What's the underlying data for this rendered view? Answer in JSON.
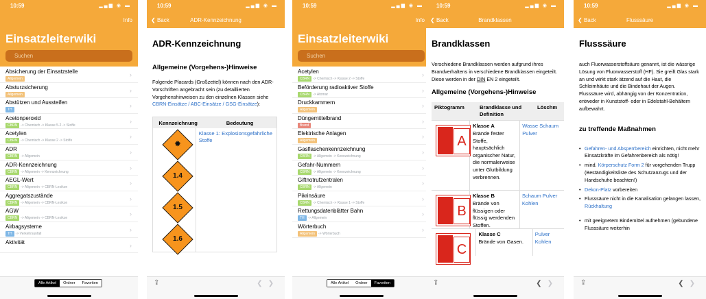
{
  "status": {
    "time": "10:59",
    "icons": "▂▄▆ ◉ ▬"
  },
  "colors": {
    "accent": "#f5a93a",
    "search_bg": "#c96f1c",
    "link": "#2b6fc7",
    "cbrn": "#a8d86e",
    "allgemein": "#f3c27a",
    "th": "#7fb7e6",
    "brand": "#e8867a"
  },
  "screen1": {
    "nav_info": "Info",
    "title": "Einsatzleiterwiki",
    "search_placeholder": "Suchen",
    "items": [
      {
        "name": "Absicherung der Einsatzstelle",
        "badge": "Allgemein",
        "badge_color": "allgemein",
        "path": ""
      },
      {
        "name": "Absturzsicherung",
        "badge": "Allgemein",
        "badge_color": "allgemein",
        "path": ""
      },
      {
        "name": "Abstützen und Aussteifen",
        "badge": "TH",
        "badge_color": "th",
        "path": ""
      },
      {
        "name": "Acetonperoxid",
        "badge": "CBRN",
        "badge_color": "cbrn",
        "path": "-> Chemisch -> Klasse 5-2 -> Stoffe"
      },
      {
        "name": "Acetylen",
        "badge": "CBRN",
        "badge_color": "cbrn",
        "path": "-> Chemisch -> Klasse 2 -> Stoffe"
      },
      {
        "name": "ADR",
        "badge": "CBRN",
        "badge_color": "cbrn",
        "path": "-> Allgemein"
      },
      {
        "name": "ADR-Kennzeichnung",
        "badge": "CBRN",
        "badge_color": "cbrn",
        "path": "-> Allgemein -> Kennzeichnung"
      },
      {
        "name": "AEGL-Wert",
        "badge": "CBRN",
        "badge_color": "cbrn",
        "path": "-> Allgemein -> CBRN-Lexikon"
      },
      {
        "name": "Aggregatszustände",
        "badge": "CBRN",
        "badge_color": "cbrn",
        "path": "-> Allgemein -> CBRN-Lexikon"
      },
      {
        "name": "AGW",
        "badge": "CBRN",
        "badge_color": "cbrn",
        "path": "-> Allgemein -> CBRN-Lexikon"
      },
      {
        "name": "Airbagsysteme",
        "badge": "TH",
        "badge_color": "th",
        "path": "-> Verkehrsunfall"
      },
      {
        "name": "Aktivität",
        "badge": "",
        "badge_color": "cbrn",
        "path": ""
      }
    ],
    "tabs": [
      "Alle Artikel",
      "Ordner",
      "Favoriten"
    ]
  },
  "screen2": {
    "nav_back": "Back",
    "nav_title": "ADR-Kennzeichnung",
    "h1": "ADR-Kennzeichnung",
    "h2": "Allgemeine (Vorgehens-)Hinweise",
    "para_text": "Folgende Placards (Großzettel) können nach den ADR-Vorschriften angebracht sein (zu detaillierten Vorgehenshinweisen zu den einzelnen Klassen siehe",
    "para_link": "CBRN-Einsätze / ABC-Einsätze / GSG-Einsätze",
    "para_end": "):",
    "table_h1": "Kennzeichnung",
    "table_h2": "Bedeutung",
    "table_row1": "Klasse 1: Explosionsgefährliche Stoffe",
    "placards": [
      "",
      "1.4",
      "1.5",
      "1.6"
    ]
  },
  "screen3": {
    "nav_info": "Info",
    "title": "Einsatzleiterwiki",
    "search_placeholder": "Suchen",
    "items": [
      {
        "name": "Acetylen",
        "badge": "CBRN",
        "badge_color": "cbrn",
        "path": "-> Chemisch -> Klasse 2 -> Stoffe"
      },
      {
        "name": "Beförderung radioaktiver Stoffe",
        "badge": "CBRN",
        "badge_color": "cbrn",
        "path": "-> Atomar"
      },
      {
        "name": "Druckkammern",
        "badge": "Allgemein",
        "badge_color": "allgemein",
        "path": ""
      },
      {
        "name": "Düngemittelbrand",
        "badge": "Brand",
        "badge_color": "brand",
        "path": ""
      },
      {
        "name": "Elektrische Anlagen",
        "badge": "Allgemein",
        "badge_color": "allgemein",
        "path": ""
      },
      {
        "name": "Gasflaschenkennzeichnung",
        "badge": "CBRN",
        "badge_color": "cbrn",
        "path": "-> Allgemein -> Kennzeichnung"
      },
      {
        "name": "Gefahr-Nummern",
        "badge": "CBRN",
        "badge_color": "cbrn",
        "path": "-> Allgemein -> Kennzeichnung"
      },
      {
        "name": "Giftnotrufzentralen",
        "badge": "CBRN",
        "badge_color": "cbrn",
        "path": "-> Allgemein"
      },
      {
        "name": "Pikrinsäure",
        "badge": "CBRN",
        "badge_color": "cbrn",
        "path": "-> Chemisch -> Klasse 1 -> Stoffe"
      },
      {
        "name": "Rettungsdatenblätter Bahn",
        "badge": "TH",
        "badge_color": "th",
        "path": "-> Allgemein"
      },
      {
        "name": "Wörterbuch",
        "badge": "Allgemein",
        "badge_color": "allgemein",
        "path": "-> Wörterbuch"
      }
    ],
    "tabs": [
      "Alle Artikel",
      "Ordner",
      "Favoriten"
    ]
  },
  "screen4": {
    "nav_back": "Back",
    "nav_title": "Brandklassen",
    "h1": "Brandklassen",
    "para_text": "Verschiedene Brandklassen werden aufgrund ihres Brandverhaltens in verschiedene Brandklassen eingeteilt. Diese werden in der",
    "para_link": "DIN",
    "para_end": "EN 2 eingeteilt.",
    "h2": "Allgemeine (Vorgehens-)Hinweise",
    "th1": "Piktogramm",
    "th2": "Brandklasse und Definition",
    "th3": "Löschm",
    "rows": [
      {
        "letter": "A",
        "title": "Klasse A",
        "desc": "Brände fester Stoffe, hauptsächlich organischer Natur, die normalerweise unter Glutbildung verbrennen.",
        "agents": "Wasse Schaum Pulver"
      },
      {
        "letter": "B",
        "title": "Klasse B",
        "desc": "Brände von flüssigen oder flüssig werdenden Stoffen.",
        "agents": "Schaum Pulver Kohlen"
      },
      {
        "letter": "C",
        "title": "Klasse C",
        "desc": "Brände von Gasen.",
        "agents": "Pulver Kohlen"
      }
    ]
  },
  "screen5": {
    "nav_back": "Back",
    "nav_title": "Flusssäure",
    "h1": "Flusssäure",
    "para": "auch Fluorwasserstoffsäure genannt, ist die wässrige Lösung von Fluorwasserstoff (HF). Sie greift Glas stark an und wirkt stark ätzend auf die Haut, die Schleimhäute und die Bindehaut der Augen. Flusssäure wird, abhängig von der Konzentration, entweder in Kunststoff- oder in Edelstahl-Behältern aufbewahrt.",
    "h2": "zu treffende Maßnahmen",
    "bullets": [
      {
        "link": "Gefahren- und Absperrbereich",
        "text": " einrichten, nicht mehr Einsatzkräfte im Gefahrenbereich als nötig!"
      },
      {
        "pre": "mind. ",
        "link": "Körperschutz Form 2",
        "text": " für vorgehenden Trupp (Beständigkeitsliste des Schutzanzugs und der Handschuhe beachten!)"
      },
      {
        "link": "Dekon-Platz",
        "text": " vorbereiten"
      },
      {
        "pre": "Flusssäure nicht in die Kanalisation gelangen lassen, ",
        "link": "Rückhaltung",
        "text": ""
      },
      {
        "pre": "mit geeignetem Bindemittel aufnehmen (gebundene Flusssäure weiterhin",
        "link": "",
        "text": ""
      }
    ]
  }
}
